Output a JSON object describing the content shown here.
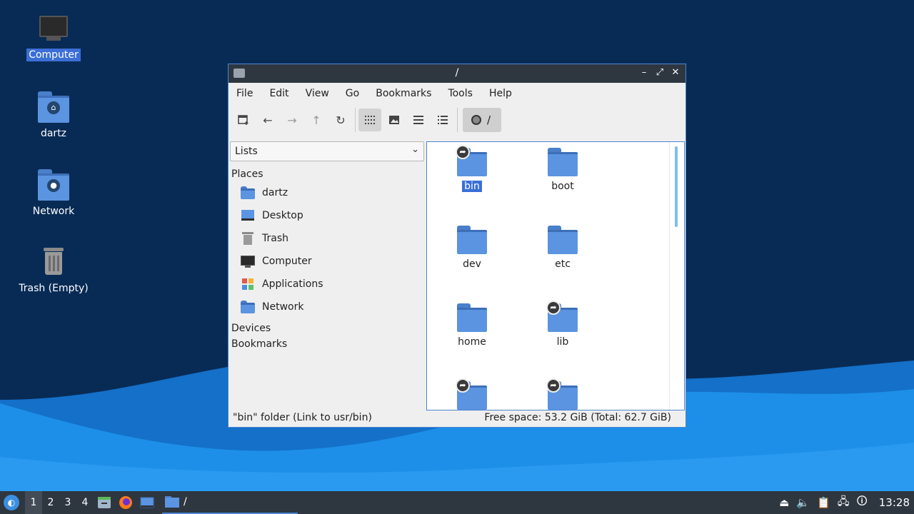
{
  "colors": {
    "accent": "#3b6fd6",
    "folder": "#5b94e0",
    "titlebar": "#2e3640",
    "wallpaper_dark": "#082b55",
    "wallpaper_light": "#1d8fe8"
  },
  "desktop": {
    "icons": [
      {
        "label": "Computer",
        "icon": "monitor-icon",
        "selected": true
      },
      {
        "label": "dartz",
        "icon": "home-folder-icon"
      },
      {
        "label": "Network",
        "icon": "network-folder-icon"
      },
      {
        "label": "Trash (Empty)",
        "icon": "trash-icon"
      }
    ]
  },
  "window": {
    "title": "/",
    "menu": [
      "File",
      "Edit",
      "View",
      "Go",
      "Bookmarks",
      "Tools",
      "Help"
    ],
    "toolbar": {
      "buttons": [
        "new-tab-icon",
        "back-icon",
        "forward-icon",
        "up-icon",
        "reload-icon",
        "icon-view-icon",
        "thumbnail-view-icon",
        "compact-view-icon",
        "detailed-list-icon"
      ],
      "location": "/"
    },
    "sidepane": {
      "mode": "Lists",
      "places_header": "Places",
      "places": [
        {
          "label": "dartz",
          "icon": "home-folder-icon"
        },
        {
          "label": "Desktop",
          "icon": "desktop-icon"
        },
        {
          "label": "Trash",
          "icon": "trash-icon"
        },
        {
          "label": "Computer",
          "icon": "monitor-icon"
        },
        {
          "label": "Applications",
          "icon": "applications-icon"
        },
        {
          "label": "Network",
          "icon": "network-icon"
        }
      ],
      "devices_header": "Devices",
      "bookmarks_header": "Bookmarks"
    },
    "files": [
      {
        "name": "bin",
        "link": true,
        "selected": true
      },
      {
        "name": "boot",
        "link": false
      },
      {
        "name": "dev",
        "link": false
      },
      {
        "name": "etc",
        "link": false
      },
      {
        "name": "home",
        "link": false
      },
      {
        "name": "lib",
        "link": true
      },
      {
        "name": "",
        "link": true
      },
      {
        "name": "",
        "link": true
      }
    ],
    "status": {
      "left": "\"bin\" folder (Link to usr/bin)",
      "right": "Free space: 53.2 GiB (Total: 62.7 GiB)"
    }
  },
  "taskbar": {
    "workspaces": [
      "1",
      "2",
      "3",
      "4"
    ],
    "active_workspace": "1",
    "task_title": "/",
    "clock": "13:28"
  }
}
